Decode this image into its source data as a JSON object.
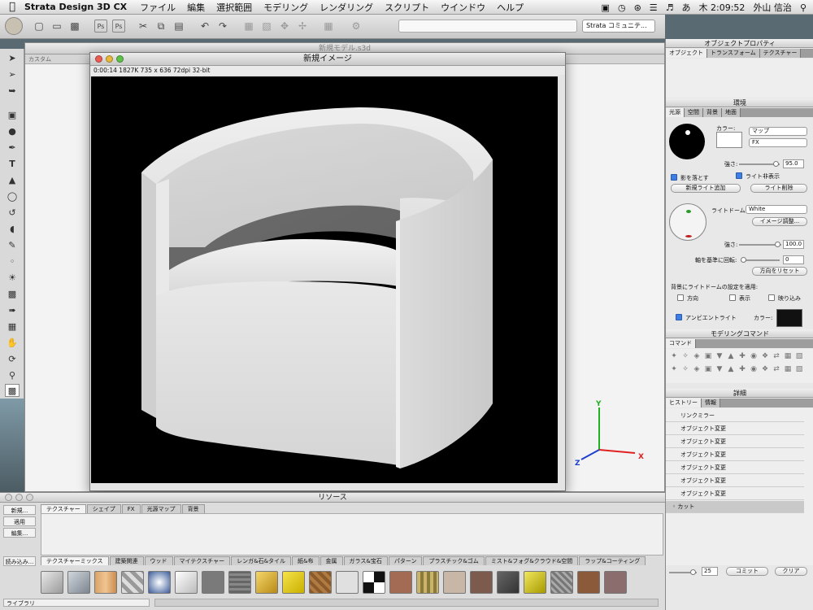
{
  "menubar": {
    "app_name": "Strata Design 3D CX",
    "items": [
      "ファイル",
      "編集",
      "選択範囲",
      "モデリング",
      "レンダリング",
      "スクリプト",
      "ウインドウ",
      "ヘルプ"
    ],
    "input_indicator": "あ",
    "clock": "木 2:09:52",
    "user": "外山 信治"
  },
  "toolbar": {
    "community_label": "Strata コミュニテ..."
  },
  "model_window": {
    "title": "新規モデル.s3d",
    "sub_label": "カスタム"
  },
  "image_window": {
    "title": "新規イメージ",
    "info": "0:00:14  1827K  735 x 636  72dpi  32-bit"
  },
  "axes": {
    "x": "X",
    "y": "Y",
    "z": "Z"
  },
  "resources": {
    "title": "リソース",
    "side_buttons": [
      "新規...",
      "適用",
      "編集..."
    ],
    "load_button": "読み込み...",
    "library_label": "ライブラリ",
    "tabs": [
      "テクスチャー",
      "シェイプ",
      "FX",
      "光源マップ",
      "背景"
    ],
    "category_tabs": [
      "テクスチャーミックス",
      "建築関連",
      "ウッド",
      "マイテクスチャー",
      "レンガ&石&タイル",
      "紙&布",
      "金属",
      "ガラス&宝石",
      "パターン",
      "プラスチック&ゴム",
      "ミスト&フォグ&クラウド&空間",
      "ラップ&コーティング"
    ]
  },
  "object_properties": {
    "title": "オブジェクトプロパティ",
    "tabs": [
      "オブジェクト",
      "トランスフォーム",
      "テクスチャー"
    ]
  },
  "environment": {
    "title": "環境",
    "tabs": [
      "光源",
      "空間",
      "背景",
      "地面"
    ],
    "color_label": "カラー:",
    "map_select": "マップ",
    "fx_select": "FX",
    "intensity_label": "強さ:",
    "intensity": "95.0",
    "cast_shadow": "影を落とす",
    "hide_light": "ライト非表示",
    "add_light": "新規ライト追加",
    "delete_light": "ライト削除",
    "light_dome_label": "ライトドーム:",
    "light_dome_value": "White",
    "image_adjust": "イメージ調整...",
    "dome_intensity_label": "強さ:",
    "dome_intensity": "100.0",
    "rotate_label": "軸を基準に回転:",
    "rotate": "0",
    "reset_direction": "方向をリセット",
    "apply_label": "背景にライトドームの設定を適用:",
    "opt_direction": "方向",
    "opt_display": "表示",
    "opt_reflection": "映り込み",
    "ambient_label": "アンビエントライト",
    "ambient_color_label": "カラー:"
  },
  "modeling_commands": {
    "title": "モデリングコマンド",
    "tab": "コマンド"
  },
  "details": {
    "title": "詳細",
    "tabs": [
      "ヒストリー",
      "情報"
    ],
    "history": [
      "リンクミラー",
      "オブジェクト変更",
      "オブジェクト変更",
      "オブジェクト変更",
      "オブジェクト変更",
      "オブジェクト変更",
      "オブジェクト変更",
      "カット"
    ],
    "undo_count": "25",
    "commit_button": "コミット",
    "clear_button": "クリア"
  },
  "colors": {
    "render_bg": "#000000",
    "ambient_color": "#111111",
    "x_axis": "#e02020",
    "y_axis": "#20b020",
    "z_axis": "#2040d0"
  }
}
